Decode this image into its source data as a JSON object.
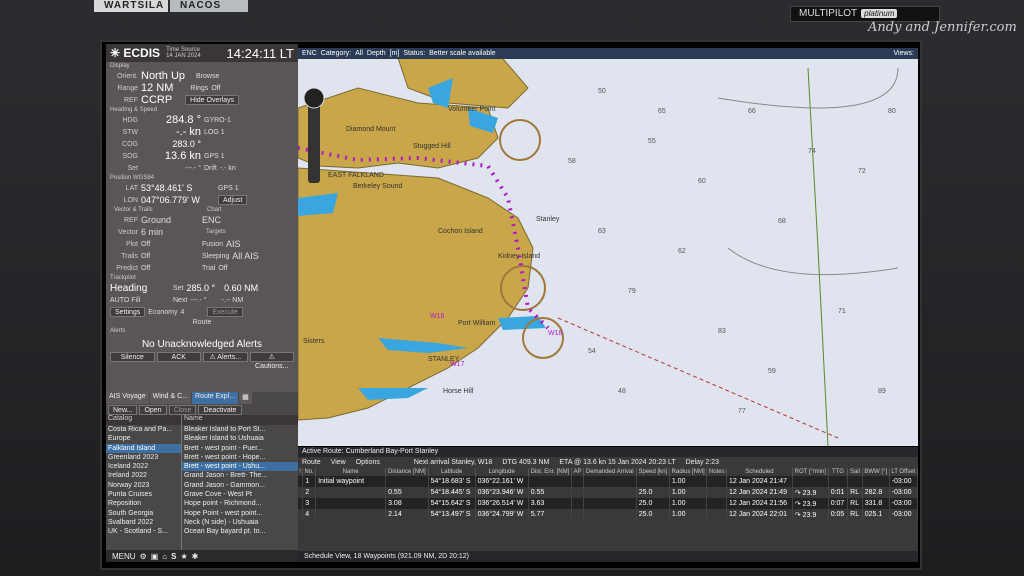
{
  "top": {
    "brand1": "WARTSILA",
    "brand2": "NACOS",
    "multipilot": "MULTIPILOT",
    "platinum": "platinum",
    "watermark": "Andy and Jennifer.com"
  },
  "ecdis": {
    "app": "ECDIS",
    "time_source": "Time Source\n14 JAN 2024",
    "clock": "14:24:11 LT",
    "display": {
      "section": "Display",
      "orient_label": "Orient.",
      "orient": "North Up",
      "browse": "Browse",
      "range_label": "Range",
      "range": "12 NM",
      "rings": "Rings",
      "rings_val": "Off",
      "ref_label": "REF",
      "ref": "CCRP",
      "hide_overlays": "Hide Overlays"
    },
    "heading": {
      "section": "Heading & Speed",
      "hdg_label": "HDG",
      "hdg": "284.8 °",
      "hdg_src": "GYRO-1",
      "stw_label": "STW",
      "stw": "-.- kn",
      "stw_src": "LOG 1",
      "cog_label": "COG",
      "cog": "283.0 °",
      "sog_label": "SOG",
      "sog": "13.6 kn",
      "sog_src": "GPS 1",
      "set_label": "Set",
      "set": "---.- °",
      "drift_label": "Drift",
      "drift": "-.- kn"
    },
    "position": {
      "section": "Position WGS84",
      "lat_label": "LAT",
      "lat": "53°48.461' S",
      "lat_src": "GPS 1",
      "lon_label": "LON",
      "lon": "047°06.779' W",
      "adjust": "Adjust"
    },
    "vector": {
      "section": "Vector & Trails",
      "chart_section": "Chart",
      "ref_label": "REF",
      "ref": "Ground",
      "chart": "ENC",
      "vector_label": "Vector",
      "vector": "6 min",
      "plot_label": "Plot",
      "plot": "Off",
      "trails_label": "Trails",
      "trails": "Off",
      "predict_label": "Predict",
      "predict": "Off",
      "targets_section": "Targets",
      "fusion_label": "Fusion",
      "fusion": "AIS",
      "sleeping_label": "Sleeping",
      "sleeping": "All AIS",
      "trial_label": "Trial",
      "trial": "Off"
    },
    "trackpilot": {
      "section": "Trackpilot",
      "heading": "Heading",
      "set_label": "Set",
      "set": "285.0 °",
      "set_nm": "0.60 NM",
      "auto_fill": "AUTO Fill",
      "next_label": "Next",
      "next": "---.- °",
      "next_nm": "-.-- NM",
      "settings": "Settings",
      "economy": "Economy",
      "economy_val": "4",
      "execute": "Execute",
      "route": "Route"
    },
    "alerts": {
      "section": "Alerts",
      "message": "No Unacknowledged Alerts",
      "silence": "Silence",
      "ack": "ACK",
      "alerts": "Alerts...",
      "cautions": "Cautions..."
    }
  },
  "lists": {
    "tabs": [
      "AIS Voyage",
      "Wind & C...",
      "Route Expl..."
    ],
    "new": "New...",
    "open": "Open",
    "close": "Close",
    "deactivate": "Deactivate",
    "catalog_hdr": "Catalog",
    "name_hdr": "Name",
    "catalog": [
      "Costa Rica and Pa...",
      "Europe",
      "Falkland Island",
      "Greenland 2023",
      "Iceland 2022",
      "Ireland 2022",
      "Norway 2023",
      "Punta Cruises",
      "Reposition",
      "South Georgia",
      "Svalbard 2022",
      "UK - Scotland - S..."
    ],
    "names": [
      "Bleaker Island to Port St...",
      "Bleaker Island to Ushuaia",
      "Brett - west point - Puer...",
      "Brett - west point - Hope...",
      "Brett - west point - Ushu...",
      "Grand Jason - Brett- The...",
      "Grand Jason - Gammon...",
      "Grave Cove - West Pt",
      "Hope point - Richmond...",
      "Hope Point - west point...",
      "Neck (N side) - Ushuaia",
      "Ocean Bay bayard pt. to..."
    ],
    "menu": "MENU"
  },
  "map": {
    "enc": "ENC",
    "category_label": "Category:",
    "category": "All",
    "depth_label": "Depth",
    "depth": "[m]",
    "status_label": "Status:",
    "status": "Better scale available",
    "views": "Views:",
    "labels": [
      "Volunteer Point",
      "Diamond Mount",
      "Stugged Hill",
      "EAST FALKLAND",
      "Berkeley Sound",
      "Cochon Island",
      "Stanley",
      "Kidney Island",
      "STANLEY",
      "Port William",
      "Sisters",
      "Horse Hill",
      "W16",
      "W17",
      "W18"
    ],
    "depths": [
      "50",
      "55",
      "60",
      "66",
      "68",
      "72",
      "79",
      "83",
      "54",
      "48",
      "62",
      "59",
      "71",
      "89",
      "65",
      "58",
      "80",
      "77",
      "63",
      "74"
    ]
  },
  "route": {
    "title": "Active Route: Cumberland Bay-Port Stanley",
    "menu": [
      "Route",
      "View",
      "Options"
    ],
    "next_arrival": "Next arrival Stanley, W18",
    "dtg": "DTG 409.3 NM",
    "eta": "ETA @ 13.6 kn 15 Jan 2024 20:23 LT",
    "delay": "Delay 2:23",
    "headers": [
      "!",
      "No.",
      "Name",
      "Distance [NM]",
      "Latitude",
      "Longitude",
      "Dist. Enr. [NM]",
      "AP",
      "Demanded Arrival",
      "Speed [kn]",
      "Radius [NM]",
      "Notes",
      "Scheduled",
      "ROT [°/min]",
      "TTG",
      "Sail",
      "BWW [°]",
      "LT Offset"
    ],
    "rows": [
      [
        "",
        "1",
        "Initial waypoint",
        "",
        "54°18.683' S",
        "036°22.161' W",
        "",
        "",
        "",
        "",
        "1.00",
        "",
        "12 Jan 2024 21:47",
        "",
        "",
        "",
        "",
        "-03:00"
      ],
      [
        "",
        "2",
        "",
        "0.55",
        "54°18.445' S",
        "036°23.946' W",
        "0.55",
        "",
        "",
        "25.0",
        "1.00",
        "",
        "12 Jan 2024 21:49",
        "↷ 23.9",
        "0:01",
        "RL",
        "282.8",
        "-03:00"
      ],
      [
        "",
        "3",
        "",
        "3.08",
        "54°15.642' S",
        "036°26.514' W",
        "3.63",
        "",
        "",
        "25.0",
        "1.00",
        "",
        "12 Jan 2024 21:56",
        "↷ 23.9",
        "0:07",
        "RL",
        "331.8",
        "-03:00"
      ],
      [
        "",
        "4",
        "",
        "2.14",
        "54°13.497' S",
        "036°24.799' W",
        "5.77",
        "",
        "",
        "25.0",
        "1.00",
        "",
        "12 Jan 2024 22:01",
        "↷ 23.9",
        "0:05",
        "RL",
        "025.1",
        "-03:00"
      ]
    ],
    "status": "Schedule View, 18 Waypoints (921.09 NM, 2D 20:12)"
  },
  "colors": {
    "land": "#c9a64a",
    "sea": "#dfe4ee",
    "shallow": "#3aa6e0",
    "purple": "#b018c8"
  }
}
